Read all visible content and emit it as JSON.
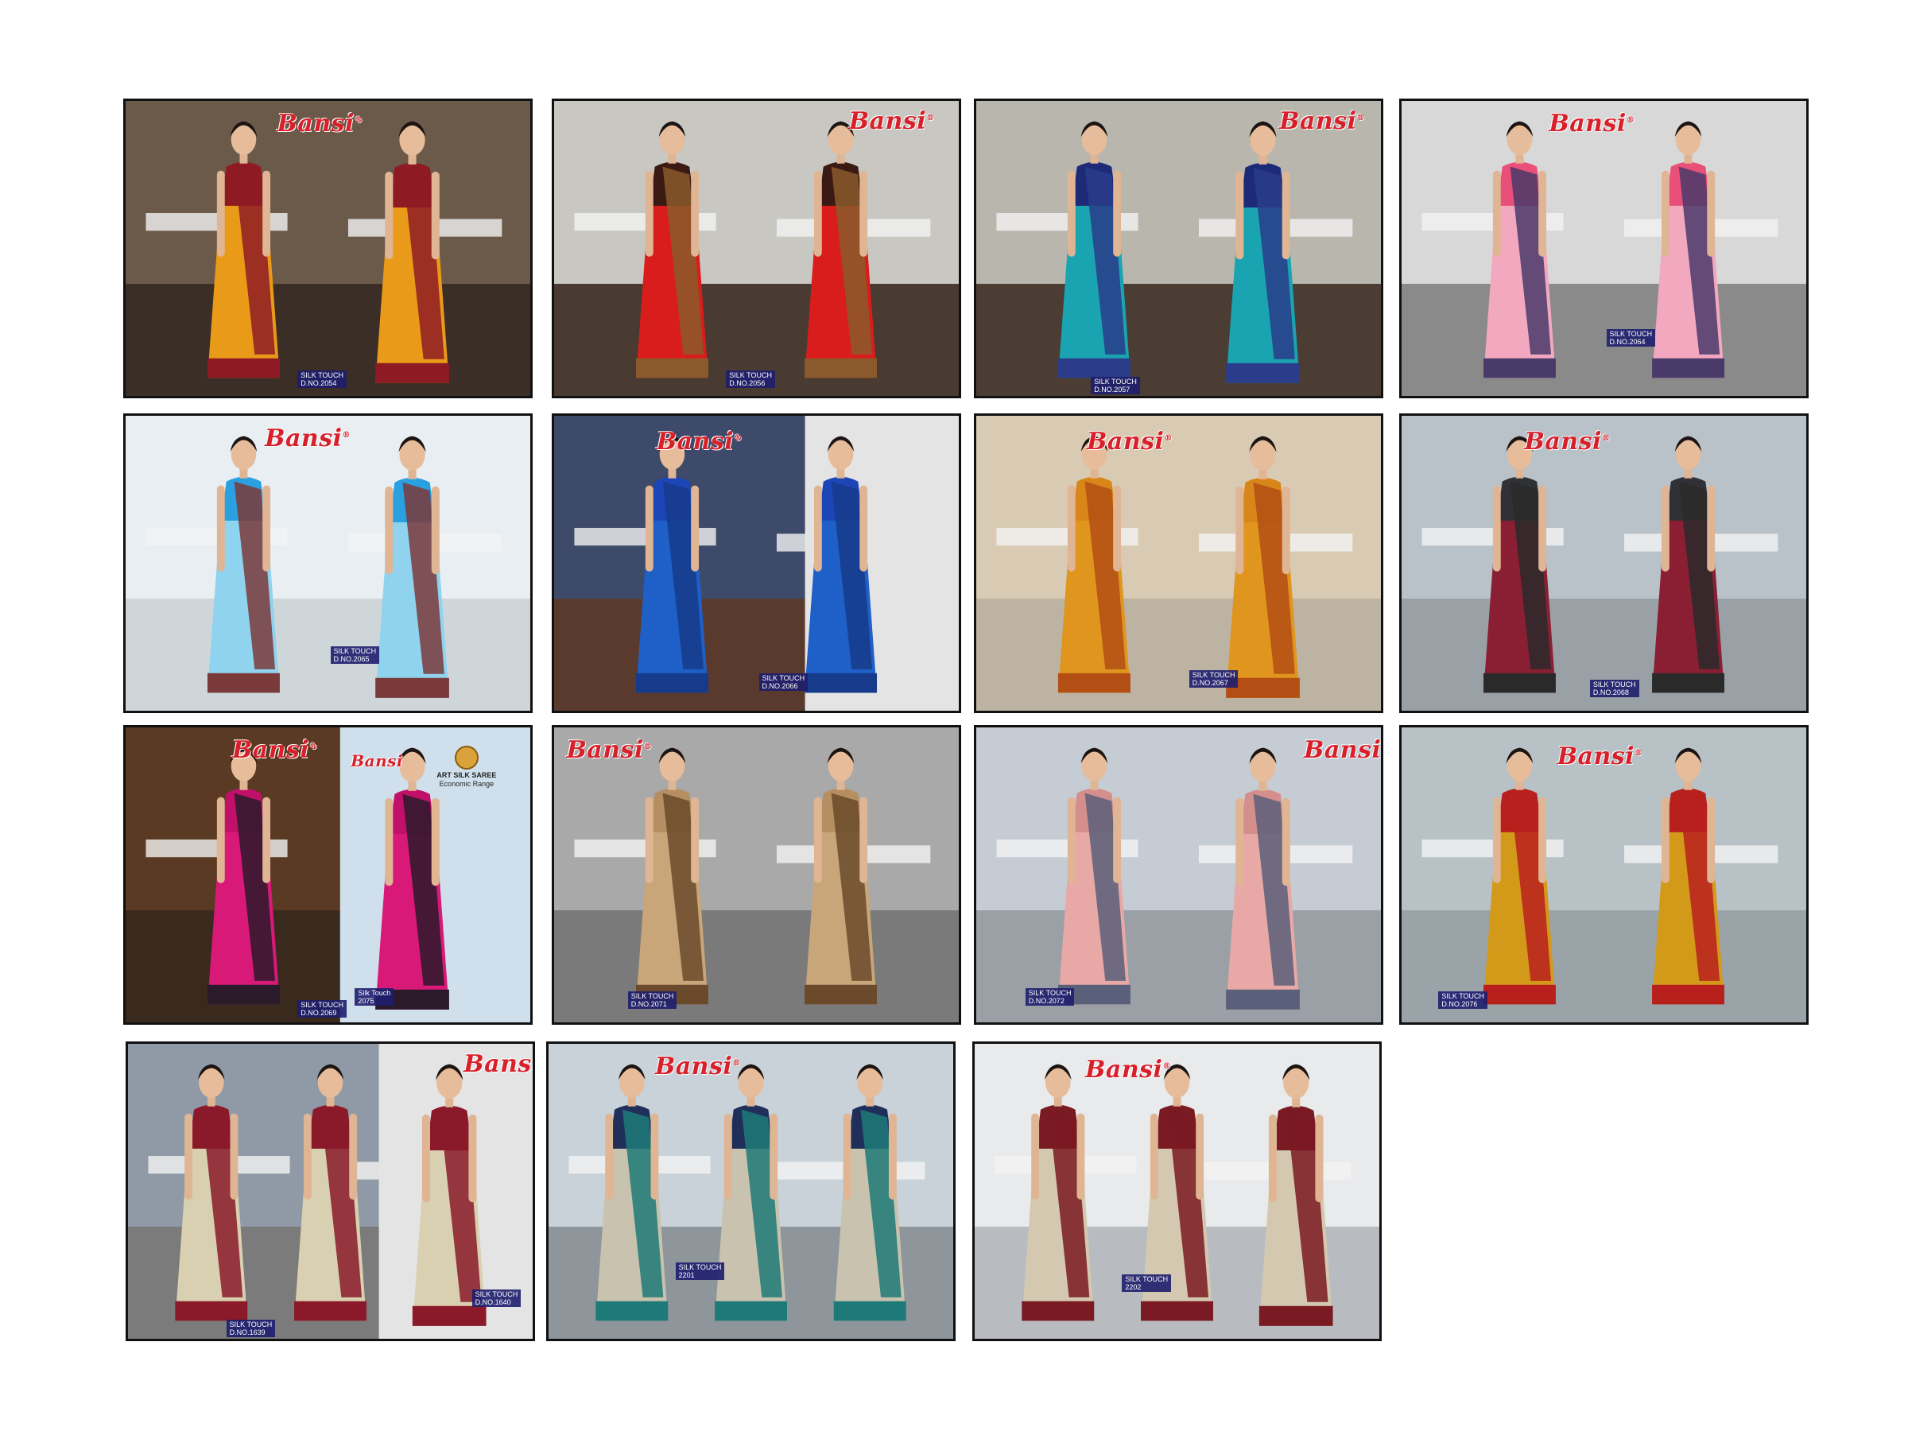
{
  "brand": "Bansi",
  "tiles": [
    {
      "id": "tile-2054",
      "fabric": "SILK TOUCH",
      "design": "D.NO.2054",
      "colors": {
        "saree": "#e89a18",
        "border": "#8e1b24",
        "blouse": "#8e1b24",
        "bg": "#6b5a4a",
        "floor": "#3a2e26"
      }
    },
    {
      "id": "tile-2056",
      "fabric": "SILK TOUCH",
      "design": "D.NO.2056",
      "colors": {
        "saree": "#d91c1c",
        "border": "#8a5a2c",
        "blouse": "#3a1a12",
        "bg": "#c9c7c2",
        "floor": "#4a3b32"
      }
    },
    {
      "id": "tile-2057",
      "fabric": "SILK TOUCH",
      "design": "D.NO.2057",
      "colors": {
        "saree": "#1aa3b0",
        "border": "#2a3c8a",
        "blouse": "#1c2a78",
        "bg": "#b9b6ae",
        "floor": "#4b3d33"
      }
    },
    {
      "id": "tile-2064",
      "fabric": "SILK TOUCH",
      "design": "D.NO.2064",
      "colors": {
        "saree": "#f2a8bf",
        "border": "#4a3a6a",
        "blouse": "#e8507a",
        "bg": "#d8d8d8",
        "floor": "#8a8a8a"
      }
    },
    {
      "id": "tile-2065",
      "fabric": "SILK TOUCH",
      "design": "D.NO.2065",
      "colors": {
        "saree": "#8fd3ef",
        "border": "#7a3a3a",
        "blouse": "#2aa0e0",
        "bg": "#e8eef2",
        "floor": "#cfd6da"
      }
    },
    {
      "id": "tile-2066",
      "fabric": "SILK TOUCH",
      "design": "D.NO.2066",
      "colors": {
        "saree": "#1f5fc8",
        "border": "#163b8a",
        "blouse": "#1c46b8",
        "bg": "#3e4a6a",
        "floor": "#5a3a2c"
      }
    },
    {
      "id": "tile-2067",
      "fabric": "SILK TOUCH",
      "design": "D.NO.2067",
      "colors": {
        "saree": "#e0951e",
        "border": "#b34e14",
        "blouse": "#d8861a",
        "bg": "#d9cbb3",
        "floor": "#bdb3a3"
      }
    },
    {
      "id": "tile-2068",
      "fabric": "SILK TOUCH",
      "design": "D.NO.2068",
      "colors": {
        "saree": "#8a1f33",
        "border": "#2a2a2a",
        "blouse": "#2f3136",
        "bg": "#b9c2c8",
        "floor": "#9aa1a6"
      }
    },
    {
      "id": "tile-2069",
      "fabric": "SILK TOUCH",
      "design": "D.NO.2069",
      "colors": {
        "saree": "#d91978",
        "border": "#2a1a2a",
        "blouse": "#c0106a",
        "bg": "#5a3a22",
        "floor": "#3a2a1e"
      }
    },
    {
      "id": "tile-2071",
      "fabric": "SILK TOUCH",
      "design": "D.NO.2071",
      "colors": {
        "saree": "#c9a57a",
        "border": "#6a4a2a",
        "blouse": "#b58f62",
        "bg": "#a9a9a9",
        "floor": "#7a7a7a"
      }
    },
    {
      "id": "tile-2072",
      "fabric": "SILK TOUCH",
      "design": "D.NO.2072",
      "colors": {
        "saree": "#e8a9a6",
        "border": "#5a5f7a",
        "blouse": "#d48f8c",
        "bg": "#c5ccd3",
        "floor": "#9aa0a6"
      }
    },
    {
      "id": "tile-2076",
      "fabric": "SILK TOUCH",
      "design": "D.NO.2076",
      "colors": {
        "saree": "#d39a1a",
        "border": "#b8201e",
        "blouse": "#b8201e",
        "bg": "#b7c1c6",
        "floor": "#9aa3a8"
      }
    },
    {
      "id": "tile-1639",
      "fabric": "SILK TOUCH",
      "design": "D.NO.1639",
      "design2": "D.NO.1640",
      "colors": {
        "saree": "#d8d0b0",
        "border": "#8a1a2a",
        "blouse": "#8a1a2a",
        "bg": "#8f9aa6",
        "floor": "#7b7b7b"
      }
    },
    {
      "id": "tile-2201",
      "fabric": "SILK TOUCH",
      "design": "2201",
      "colors": {
        "saree": "#c9c2ae",
        "border": "#1e7a78",
        "blouse": "#1f2f5a",
        "bg": "#c8d2d8",
        "floor": "#8e969c"
      }
    },
    {
      "id": "tile-2202",
      "fabric": "SILK TOUCH",
      "design": "2202",
      "colors": {
        "saree": "#d4c8b0",
        "border": "#7a1a22",
        "blouse": "#7a1a22",
        "bg": "#e8eaec",
        "floor": "#b8bcc0"
      }
    }
  ],
  "inset_2069": {
    "fabric": "Silk Touch",
    "design": "2075",
    "title": "ART SILK SAREE",
    "subtitle": "Economic Range"
  }
}
